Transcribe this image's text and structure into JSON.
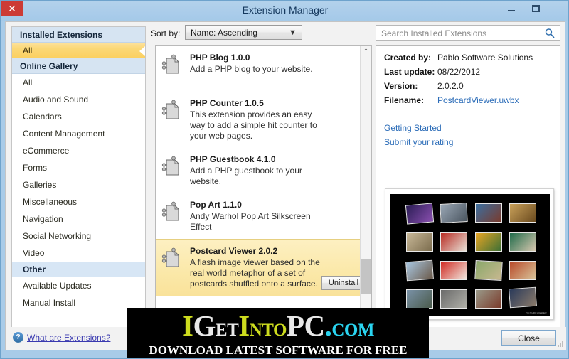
{
  "window": {
    "title": "Extension Manager",
    "controls": {
      "minimize": "minimize-icon",
      "maximize": "maximize-icon",
      "close": "✕"
    }
  },
  "toolbar": {
    "sort_label": "Sort by:",
    "sort_value": "Name: Ascending",
    "sort_options": [
      "Name: Ascending"
    ],
    "search_placeholder": "Search Installed Extensions",
    "search_value": "",
    "search_icon": "search-icon"
  },
  "sidebar": {
    "sections": [
      {
        "header": "Installed Extensions",
        "items": [
          {
            "label": "All",
            "state": "selected-yellow"
          }
        ]
      },
      {
        "header": "Online Gallery",
        "items": [
          {
            "label": "All",
            "state": "normal"
          },
          {
            "label": "Audio and Sound",
            "state": "normal"
          },
          {
            "label": "Calendars",
            "state": "normal"
          },
          {
            "label": "Content Management",
            "state": "normal"
          },
          {
            "label": "eCommerce",
            "state": "normal"
          },
          {
            "label": "Forms",
            "state": "normal"
          },
          {
            "label": "Galleries",
            "state": "normal"
          },
          {
            "label": "Miscellaneous",
            "state": "normal"
          },
          {
            "label": "Navigation",
            "state": "normal"
          },
          {
            "label": "Social Networking",
            "state": "normal"
          },
          {
            "label": "Video",
            "state": "normal"
          },
          {
            "label": "Other",
            "state": "selected-blue"
          },
          {
            "label": "Available Updates",
            "state": "normal"
          },
          {
            "label": "Manual Install",
            "state": "normal"
          }
        ]
      }
    ]
  },
  "extension_list": {
    "items": [
      {
        "title": "PHP Blog 1.0.0",
        "description": "Add a PHP blog to your website.",
        "selected": false
      },
      {
        "title": "PHP Counter 1.0.5",
        "description": "This extension provides an easy way to add a simple hit counter to your web pages.",
        "selected": false
      },
      {
        "title": "PHP Guestbook 4.1.0",
        "description": "Add a PHP guestbook to your website.",
        "selected": false
      },
      {
        "title": "Pop Art 1.1.0",
        "description": "Andy Warhol Pop Art Silkscreen Effect",
        "selected": false
      },
      {
        "title": "Postcard Viewer 2.0.2",
        "description": "A flash image viewer based on the real world metaphor of a set of postcards shuffled onto a surface.",
        "selected": true,
        "action_label": "Uninstall"
      }
    ],
    "scroll_up_glyph": "⌃",
    "scroll_down_glyph": "⌄"
  },
  "details": {
    "meta": [
      {
        "label": "Created by:",
        "value": "Pablo Software Solutions",
        "is_link": false
      },
      {
        "label": "Last update:",
        "value": "08/22/2012",
        "is_link": false
      },
      {
        "label": "Version:",
        "value": "2.0.2.0",
        "is_link": false
      },
      {
        "label": "Filename:",
        "value": "PostcardViewer.uwbx",
        "is_link": true
      }
    ],
    "links": [
      {
        "label": "Getting Started"
      },
      {
        "label": "Submit your rating"
      }
    ],
    "preview_caption": "PICTUREVIEWER"
  },
  "bottom": {
    "help_icon": "help-icon",
    "help_link": "What are Extensions?",
    "close_label": "Close"
  },
  "watermark": {
    "line1_parts": [
      {
        "t": "I",
        "cls": "wm-y"
      },
      {
        "t": "G",
        "cls": "wm-w"
      },
      {
        "t": "ET",
        "cls": "wm-w wm-sm2"
      },
      {
        "t": "I",
        "cls": "wm-y"
      },
      {
        "t": "NTO",
        "cls": "wm-y wm-sm2"
      },
      {
        "t": "PC",
        "cls": "wm-w"
      },
      {
        "t": ".",
        "cls": "wm-c"
      },
      {
        "t": "COM",
        "cls": "wm-c wm-sm2"
      }
    ],
    "line2": "DOWNLOAD LATEST SOFTWARE FOR FREE"
  },
  "colors": {
    "title_bar": "#a8cbe8",
    "close_button": "#cc3b35",
    "selected_yellow": "#fbd061",
    "selected_blue": "#d7e6f5",
    "link_blue": "#2b6cb8",
    "help_link": "#3a3ab0",
    "watermark_yellow": "#cddc1e",
    "watermark_cyan": "#2ad4f0"
  }
}
